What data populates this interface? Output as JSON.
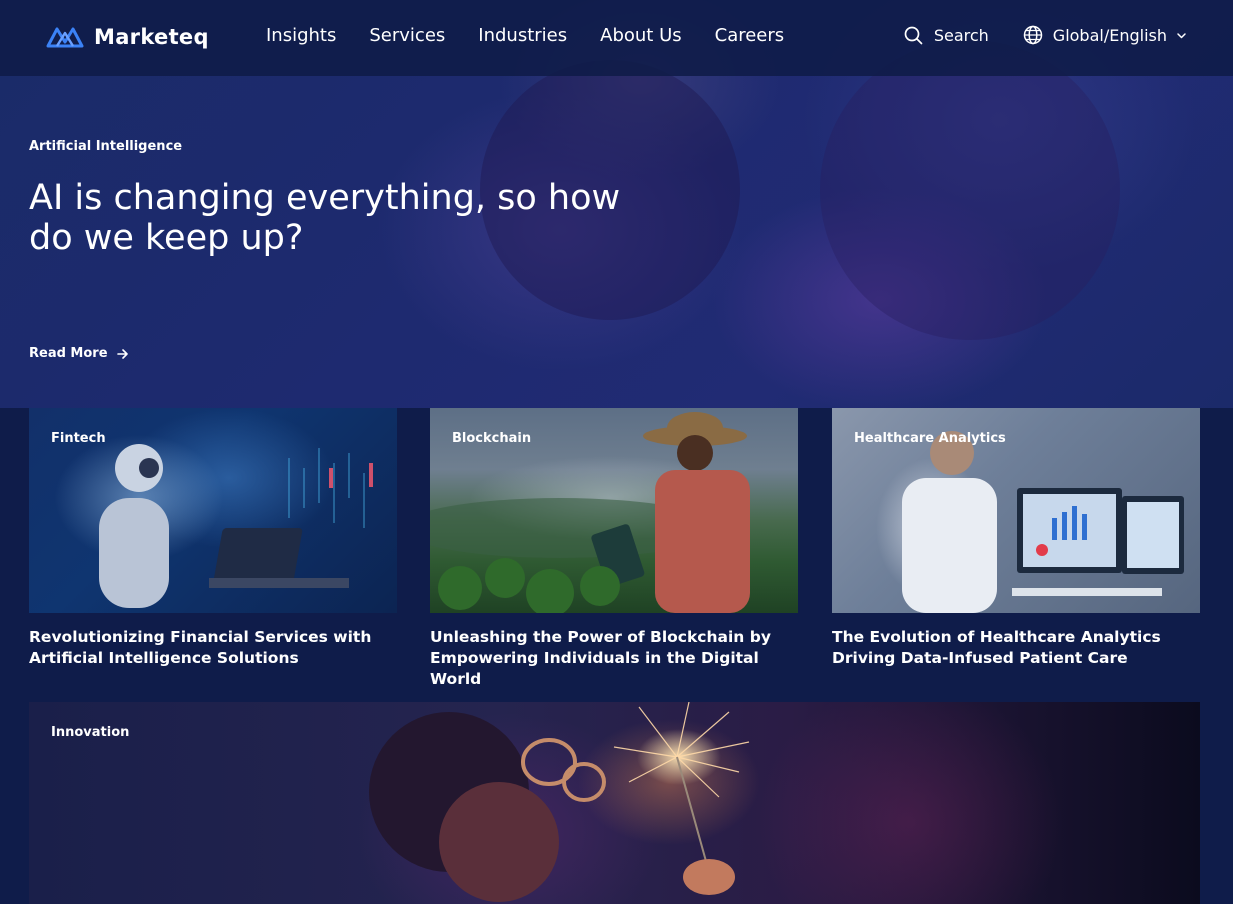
{
  "brand": {
    "name": "Marketeq"
  },
  "nav": {
    "links": [
      "Insights",
      "Services",
      "Industries",
      "About Us",
      "Careers"
    ],
    "search_label": "Search",
    "language_label": "Global/English"
  },
  "hero": {
    "tag": "Artificial Intelligence",
    "title": "AI is changing everything, so how do we keep up?",
    "read_more": "Read More"
  },
  "cards": [
    {
      "tag": "Fintech",
      "title": "Revolutionizing Financial Services with Artificial Intelligence Solutions"
    },
    {
      "tag": "Blockchain",
      "title": "Unleashing the Power of Blockchain by Empowering Individuals in the Digital World"
    },
    {
      "tag": "Healthcare Analytics",
      "title": "The Evolution of Healthcare Analytics Driving Data-Infused Patient Care"
    }
  ],
  "feature": {
    "tag": "Innovation"
  },
  "icons": {
    "logo": "marketeq-logo-icon",
    "search": "search-icon",
    "language": "globe-icon",
    "dropdown": "chevron-down-icon",
    "read_more": "arrow-right-icon"
  },
  "colors": {
    "background": "#0f1c4a",
    "nav": "#0f1b48",
    "logo_accent": "#3b82f6"
  }
}
